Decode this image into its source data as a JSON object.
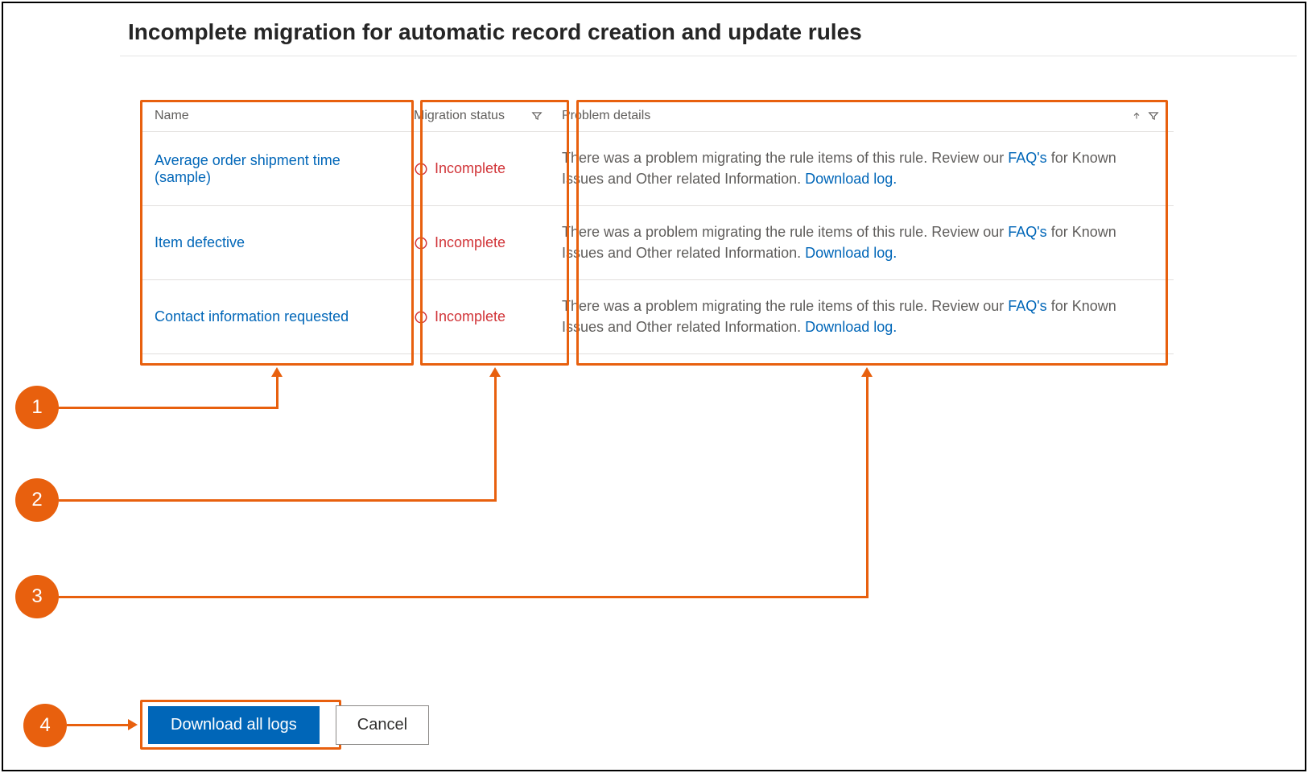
{
  "title": "Incomplete migration for automatic record creation and update rules",
  "columns": {
    "name": "Name",
    "status": "Migration status",
    "details": "Problem details"
  },
  "status_label": "Incomplete",
  "problem_text_before": "There was a problem migrating the rule items of this rule. Review our ",
  "faq_link": "FAQ's",
  "problem_text_mid": " for Known Issues and Other related Information. ",
  "download_log_link": "Download log.",
  "rows": [
    {
      "name": "Average order shipment time (sample)"
    },
    {
      "name": "Item defective"
    },
    {
      "name": "Contact information requested"
    }
  ],
  "buttons": {
    "download_all": "Download all logs",
    "cancel": "Cancel"
  },
  "callouts": {
    "c1": "1",
    "c2": "2",
    "c3": "3",
    "c4": "4"
  }
}
